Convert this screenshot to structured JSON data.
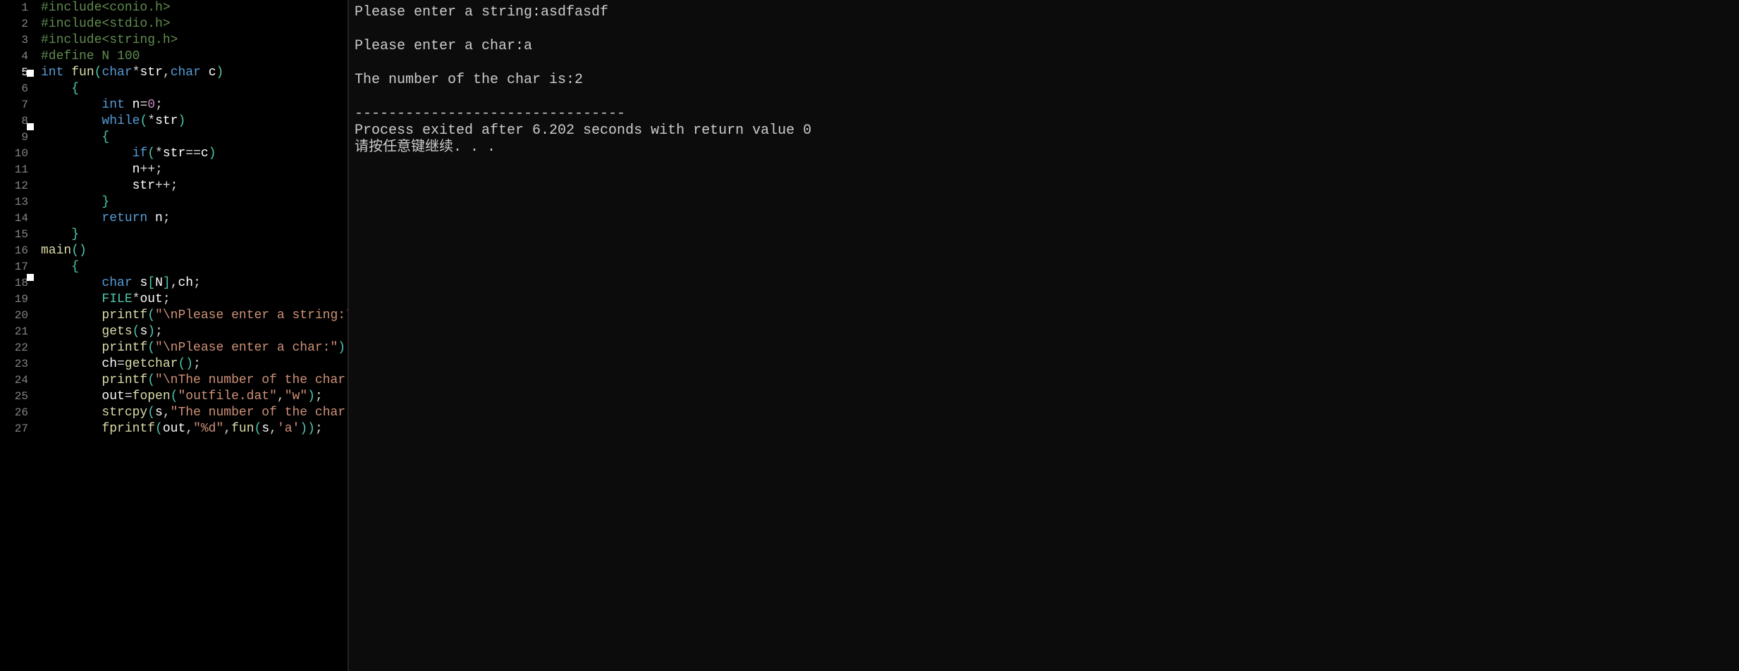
{
  "editor": {
    "current_line": 5,
    "fold_markers_after_line": [
      5,
      8,
      17
    ],
    "lines": [
      {
        "n": 1,
        "tokens": [
          {
            "t": "#include<conio.h>",
            "c": "pp"
          }
        ]
      },
      {
        "n": 2,
        "tokens": [
          {
            "t": "#include<stdio.h>",
            "c": "pp"
          }
        ]
      },
      {
        "n": 3,
        "tokens": [
          {
            "t": "#include<string.h>",
            "c": "pp"
          }
        ]
      },
      {
        "n": 4,
        "tokens": [
          {
            "t": "#define N 100",
            "c": "pp"
          }
        ]
      },
      {
        "n": 5,
        "tokens": [
          {
            "t": "int ",
            "c": "kw"
          },
          {
            "t": "fun",
            "c": "fn"
          },
          {
            "t": "(",
            "c": "paren"
          },
          {
            "t": "char",
            "c": "kw"
          },
          {
            "t": "*",
            "c": "op"
          },
          {
            "t": "str",
            "c": "id"
          },
          {
            "t": ",",
            "c": "op"
          },
          {
            "t": "char ",
            "c": "kw"
          },
          {
            "t": "c",
            "c": "id"
          },
          {
            "t": ")",
            "c": "paren"
          }
        ]
      },
      {
        "n": 6,
        "indent": 1,
        "tokens": [
          {
            "t": "{",
            "c": "brc"
          }
        ]
      },
      {
        "n": 7,
        "indent": 2,
        "tokens": [
          {
            "t": "int ",
            "c": "kw"
          },
          {
            "t": "n",
            "c": "id"
          },
          {
            "t": "=",
            "c": "op"
          },
          {
            "t": "0",
            "c": "num0"
          },
          {
            "t": ";",
            "c": "op"
          }
        ]
      },
      {
        "n": 8,
        "indent": 2,
        "tokens": [
          {
            "t": "while",
            "c": "kw"
          },
          {
            "t": "(",
            "c": "paren"
          },
          {
            "t": "*",
            "c": "op"
          },
          {
            "t": "str",
            "c": "id"
          },
          {
            "t": ")",
            "c": "paren"
          }
        ]
      },
      {
        "n": 9,
        "indent": 2,
        "tokens": [
          {
            "t": "{",
            "c": "brc"
          }
        ]
      },
      {
        "n": 10,
        "indent": 3,
        "tokens": [
          {
            "t": "if",
            "c": "kw"
          },
          {
            "t": "(",
            "c": "paren"
          },
          {
            "t": "*",
            "c": "op"
          },
          {
            "t": "str",
            "c": "id"
          },
          {
            "t": "==",
            "c": "op"
          },
          {
            "t": "c",
            "c": "id"
          },
          {
            "t": ")",
            "c": "paren"
          }
        ]
      },
      {
        "n": 11,
        "indent": 3,
        "tokens": [
          {
            "t": "n",
            "c": "id"
          },
          {
            "t": "++",
            "c": "op"
          },
          {
            "t": ";",
            "c": "op"
          }
        ]
      },
      {
        "n": 12,
        "indent": 3,
        "tokens": [
          {
            "t": "str",
            "c": "id"
          },
          {
            "t": "++",
            "c": "op"
          },
          {
            "t": ";",
            "c": "op"
          }
        ]
      },
      {
        "n": 13,
        "indent": 2,
        "tokens": [
          {
            "t": "}",
            "c": "brc"
          }
        ]
      },
      {
        "n": 14,
        "indent": 2,
        "tokens": [
          {
            "t": "return ",
            "c": "kw"
          },
          {
            "t": "n",
            "c": "id"
          },
          {
            "t": ";",
            "c": "op"
          }
        ]
      },
      {
        "n": 15,
        "indent": 1,
        "tokens": [
          {
            "t": "}",
            "c": "brc"
          }
        ]
      },
      {
        "n": 16,
        "tokens": [
          {
            "t": "main",
            "c": "fn"
          },
          {
            "t": "()",
            "c": "paren"
          }
        ]
      },
      {
        "n": 17,
        "indent": 1,
        "tokens": [
          {
            "t": "{",
            "c": "brc"
          }
        ]
      },
      {
        "n": 18,
        "indent": 2,
        "tokens": [
          {
            "t": "char ",
            "c": "kw"
          },
          {
            "t": "s",
            "c": "id"
          },
          {
            "t": "[",
            "c": "brc"
          },
          {
            "t": "N",
            "c": "id"
          },
          {
            "t": "]",
            "c": "brc"
          },
          {
            "t": ",",
            "c": "op"
          },
          {
            "t": "ch",
            "c": "id"
          },
          {
            "t": ";",
            "c": "op"
          }
        ]
      },
      {
        "n": 19,
        "indent": 2,
        "tokens": [
          {
            "t": "FILE",
            "c": "typ"
          },
          {
            "t": "*",
            "c": "op"
          },
          {
            "t": "out",
            "c": "id"
          },
          {
            "t": ";",
            "c": "op"
          }
        ]
      },
      {
        "n": 20,
        "indent": 2,
        "tokens": [
          {
            "t": "printf",
            "c": "fn"
          },
          {
            "t": "(",
            "c": "paren"
          },
          {
            "t": "\"\\nPlease enter a string:\"",
            "c": "str"
          },
          {
            "t": ")",
            "c": "paren"
          },
          {
            "t": ";",
            "c": "op"
          }
        ]
      },
      {
        "n": 21,
        "indent": 2,
        "tokens": [
          {
            "t": "gets",
            "c": "fn"
          },
          {
            "t": "(",
            "c": "paren"
          },
          {
            "t": "s",
            "c": "id"
          },
          {
            "t": ")",
            "c": "paren"
          },
          {
            "t": ";",
            "c": "op"
          }
        ]
      },
      {
        "n": 22,
        "indent": 2,
        "tokens": [
          {
            "t": "printf",
            "c": "fn"
          },
          {
            "t": "(",
            "c": "paren"
          },
          {
            "t": "\"\\nPlease enter a char:\"",
            "c": "str"
          },
          {
            "t": ")",
            "c": "paren"
          },
          {
            "t": ";",
            "c": "op"
          }
        ]
      },
      {
        "n": 23,
        "indent": 2,
        "tokens": [
          {
            "t": "ch",
            "c": "id"
          },
          {
            "t": "=",
            "c": "op"
          },
          {
            "t": "getchar",
            "c": "fn"
          },
          {
            "t": "()",
            "c": "paren"
          },
          {
            "t": ";",
            "c": "op"
          }
        ]
      },
      {
        "n": 24,
        "indent": 2,
        "tokens": [
          {
            "t": "printf",
            "c": "fn"
          },
          {
            "t": "(",
            "c": "paren"
          },
          {
            "t": "\"\\nThe number of the char is:%d\"",
            "c": "str"
          }
        ]
      },
      {
        "n": 25,
        "indent": 2,
        "tokens": [
          {
            "t": "out",
            "c": "id"
          },
          {
            "t": "=",
            "c": "op"
          },
          {
            "t": "fopen",
            "c": "fn"
          },
          {
            "t": "(",
            "c": "paren"
          },
          {
            "t": "\"outfile.dat\"",
            "c": "str"
          },
          {
            "t": ",",
            "c": "op"
          },
          {
            "t": "\"w\"",
            "c": "str"
          },
          {
            "t": ")",
            "c": "paren"
          },
          {
            "t": ";",
            "c": "op"
          }
        ]
      },
      {
        "n": 26,
        "indent": 2,
        "tokens": [
          {
            "t": "strcpy",
            "c": "fn"
          },
          {
            "t": "(",
            "c": "paren"
          },
          {
            "t": "s",
            "c": "id"
          },
          {
            "t": ",",
            "c": "op"
          },
          {
            "t": "\"The number of the char is:\"",
            "c": "str"
          },
          {
            "t": ")",
            "c": "paren"
          },
          {
            "t": ";",
            "c": "op"
          }
        ]
      },
      {
        "n": 27,
        "indent": 2,
        "tokens": [
          {
            "t": "fprintf",
            "c": "fn"
          },
          {
            "t": "(",
            "c": "paren"
          },
          {
            "t": "out",
            "c": "id"
          },
          {
            "t": ",",
            "c": "op"
          },
          {
            "t": "\"%d\"",
            "c": "str"
          },
          {
            "t": ",",
            "c": "op"
          },
          {
            "t": "fun",
            "c": "fn"
          },
          {
            "t": "(",
            "c": "paren"
          },
          {
            "t": "s",
            "c": "id"
          },
          {
            "t": ",",
            "c": "op"
          },
          {
            "t": "'a'",
            "c": "sch"
          },
          {
            "t": "))",
            "c": "paren"
          },
          {
            "t": ";",
            "c": "op"
          }
        ]
      }
    ]
  },
  "console": {
    "lines": [
      "Please enter a string:asdfasdf",
      "",
      "Please enter a char:a",
      "",
      "The number of the char is:2",
      "",
      "--------------------------------",
      "Process exited after 6.202 seconds with return value 0",
      "请按任意键继续. . ."
    ]
  }
}
